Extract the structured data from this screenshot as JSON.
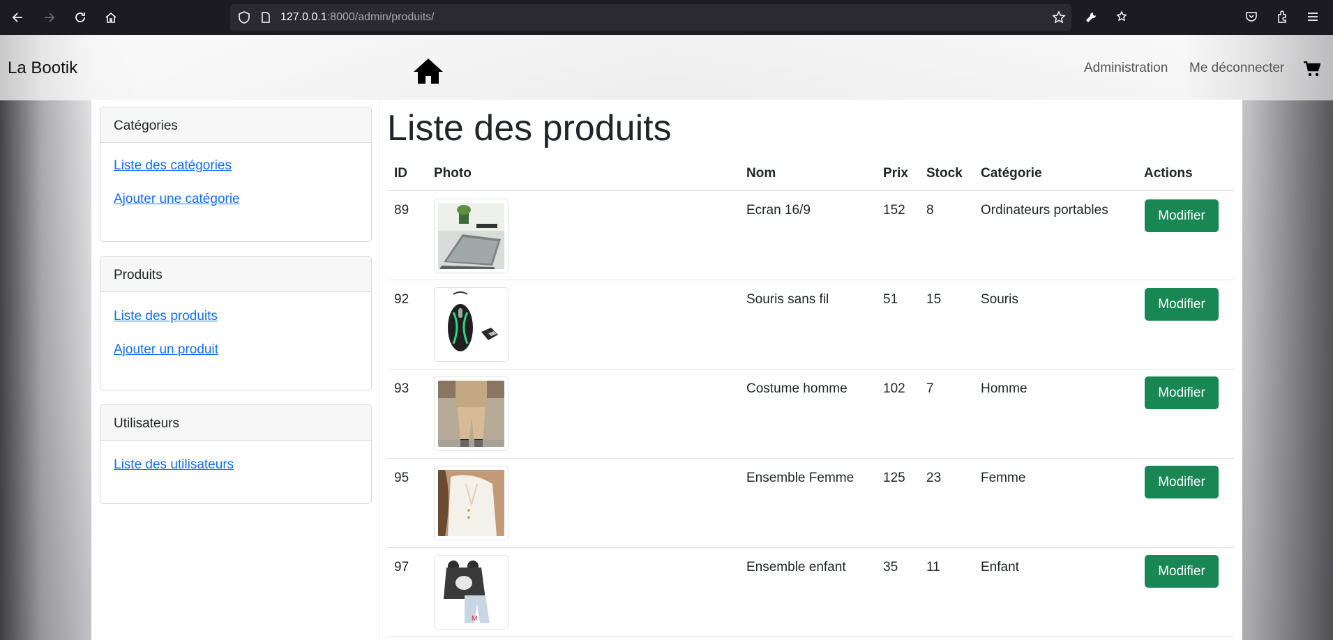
{
  "browser": {
    "url_host": "127.0.0.1",
    "url_path": ":8000/admin/produits/"
  },
  "site": {
    "brand": "La Bootik",
    "nav_admin": "Administration",
    "nav_logout": "Me déconnecter"
  },
  "sidebar": {
    "categories": {
      "title": "Catégories",
      "links": [
        "Liste des catégories",
        "Ajouter une catégorie"
      ]
    },
    "products": {
      "title": "Produits",
      "links": [
        "Liste des produits",
        "Ajouter un produit"
      ]
    },
    "users": {
      "title": "Utilisateurs",
      "links": [
        "Liste des utilisateurs"
      ]
    }
  },
  "main": {
    "title": "Liste des produits",
    "columns": [
      "ID",
      "Photo",
      "Nom",
      "Prix",
      "Stock",
      "Catégorie",
      "Actions"
    ],
    "rows": [
      {
        "id": "89",
        "name": "Ecran 16/9",
        "price": "152",
        "stock": "8",
        "category": "Ordinateurs portables",
        "action": "Modifier",
        "photo": "laptop-photo"
      },
      {
        "id": "92",
        "name": "Souris sans fil",
        "price": "51",
        "stock": "15",
        "category": "Souris",
        "action": "Modifier",
        "photo": "mouse-photo"
      },
      {
        "id": "93",
        "name": "Costume homme",
        "price": "102",
        "stock": "7",
        "category": "Homme",
        "action": "Modifier",
        "photo": "mens-suit-photo"
      },
      {
        "id": "95",
        "name": "Ensemble Femme",
        "price": "125",
        "stock": "23",
        "category": "Femme",
        "action": "Modifier",
        "photo": "womens-outfit-photo"
      },
      {
        "id": "97",
        "name": "Ensemble enfant",
        "price": "35",
        "stock": "11",
        "category": "Enfant",
        "action": "Modifier",
        "photo": "kids-outfit-photo"
      }
    ]
  },
  "colors": {
    "link": "#0d6efd",
    "button": "#198754",
    "browser_chrome": "#1c1b22"
  }
}
